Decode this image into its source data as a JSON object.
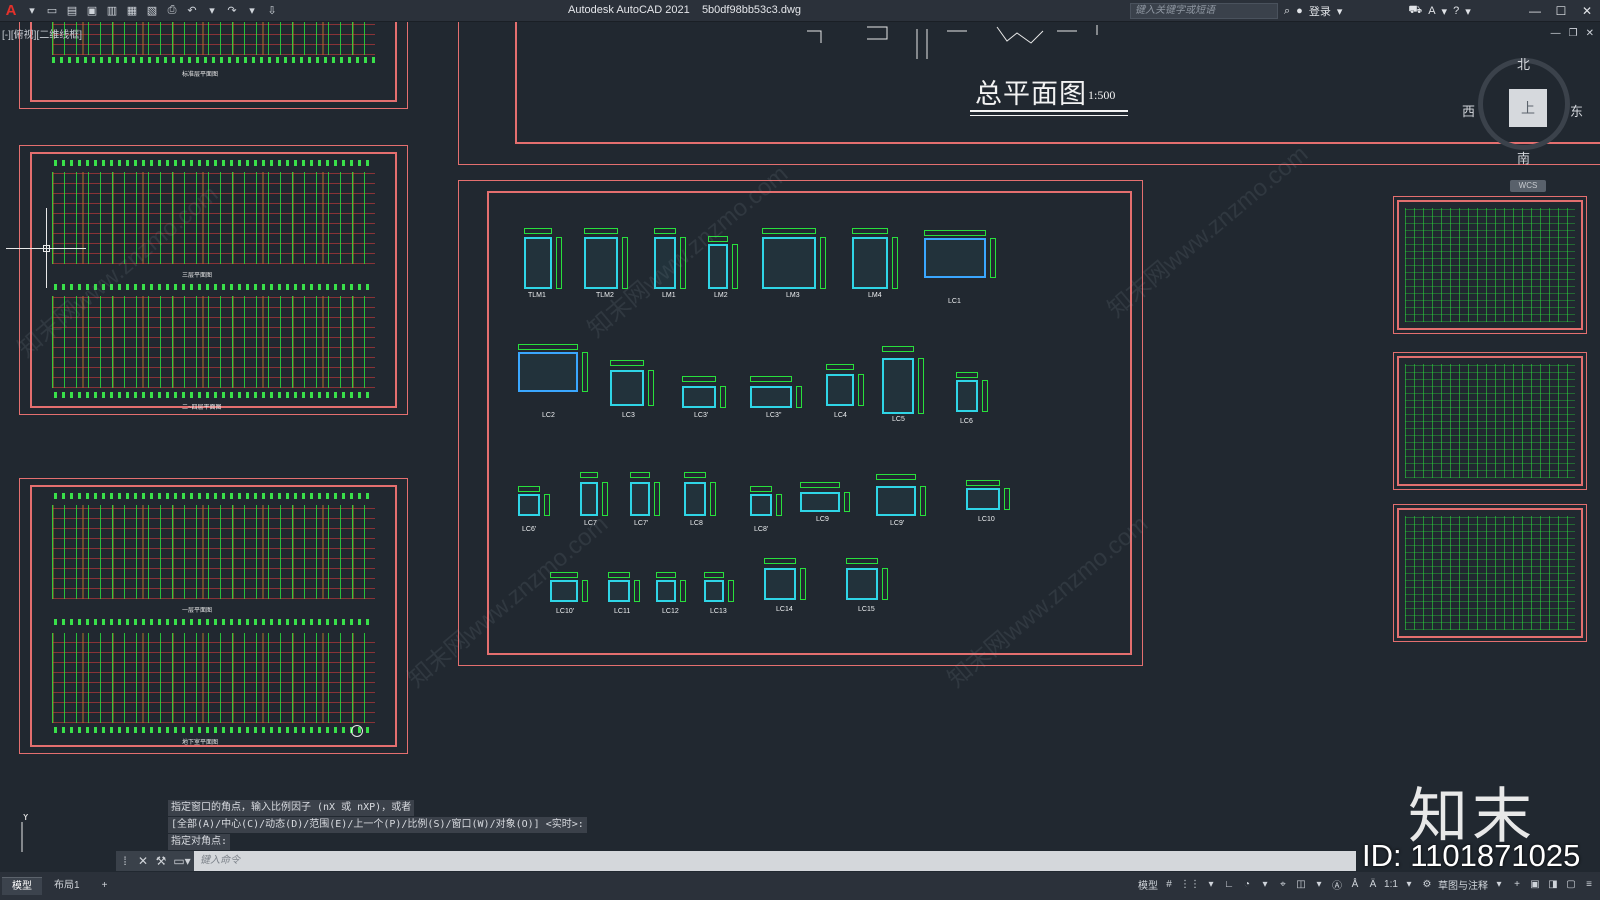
{
  "titlebar": {
    "app_name": "Autodesk AutoCAD 2021",
    "file_name": "5b0df98bb53c3.dwg",
    "search_placeholder": "键入关键字或短语",
    "login": "登录"
  },
  "viewport": {
    "view_label": "[-][俯视][二维线框]"
  },
  "site_plan": {
    "title": "总平面图",
    "scale": "1:500"
  },
  "viewcube": {
    "north": "北",
    "south": "南",
    "east": "东",
    "west": "西",
    "face": "上",
    "wcs": "WCS"
  },
  "plans": {
    "sheet1_caption": "标准层平面图",
    "sheet2_top_caption": "三层平面图",
    "sheet2_bottom_caption": "二~四层平面图",
    "sheet3_top_caption": "一层平面图",
    "sheet3_bottom_caption": "地下室平面图"
  },
  "windows": {
    "row1": [
      "TLM1",
      "TLM2",
      "LM1",
      "LM2",
      "LM3",
      "LM4",
      "LC1"
    ],
    "row2": [
      "LC2",
      "LC3",
      "LC3'",
      "LC3''",
      "LC4",
      "LC5",
      "LC6"
    ],
    "row3": [
      "LC6'",
      "LC7",
      "LC7'",
      "LC8",
      "LC8'",
      "LC9",
      "LC9'",
      "LC10"
    ],
    "row4": [
      "LC10'",
      "LC11",
      "LC12",
      "LC13",
      "LC14",
      "LC15"
    ]
  },
  "command": {
    "history": [
      "指定窗口的角点，输入比例因子 (nX 或 nXP)，或者",
      "[全部(A)/中心(C)/动态(D)/范围(E)/上一个(P)/比例(S)/窗口(W)/对象(O)] <实时>:",
      "指定对角点:"
    ],
    "input_placeholder": "键入命令"
  },
  "statusbar": {
    "tab_model": "模型",
    "tab_layout1": "布局1",
    "tab_add": "+",
    "model_label": "模型",
    "scale": "1:1",
    "workspace": "草图与注释"
  },
  "watermark": {
    "logo": "知末",
    "id": "ID: 1101871025",
    "site": "知末网www.znzmo.com"
  }
}
